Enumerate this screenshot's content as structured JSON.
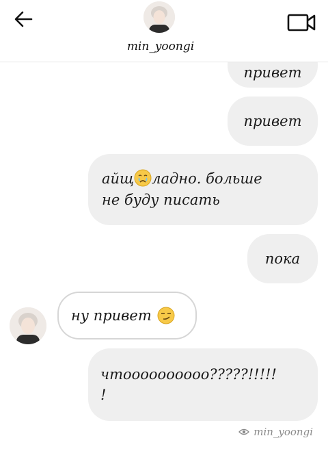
{
  "header": {
    "username": "min_yoongi",
    "icons": {
      "back": "arrow-left-icon",
      "video_call": "video-camera-icon"
    }
  },
  "messages": [
    {
      "direction": "outgoing",
      "text": "привет"
    },
    {
      "direction": "outgoing",
      "text": "привет"
    },
    {
      "direction": "outgoing",
      "text_before_emoji": "айщ",
      "emoji": "crying-face",
      "text_after_emoji": "ладно. больше",
      "text_line2": "не буду писать"
    },
    {
      "direction": "outgoing",
      "text": "пока"
    },
    {
      "direction": "incoming",
      "text": "ну привет",
      "emoji": "smirk-face"
    },
    {
      "direction": "outgoing",
      "text_line1": "чтоооооооооо?????!!!!!",
      "text_line2": "!"
    }
  ],
  "seen": {
    "icon": "eye-icon",
    "label": "min_yoongi"
  },
  "colors": {
    "outgoing_bubble": "#efefef",
    "incoming_bubble_border": "#d6d6d6",
    "text": "#1a1a1a",
    "seen_text": "#8a8a8a"
  }
}
